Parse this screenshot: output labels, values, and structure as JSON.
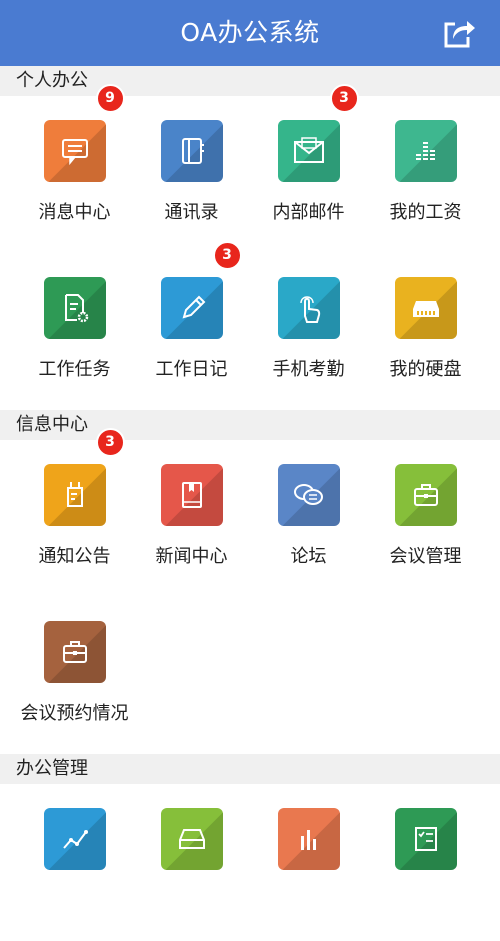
{
  "header": {
    "title": "OA办公系统"
  },
  "sections": [
    {
      "title": "个人办公",
      "items": [
        {
          "label": "消息中心",
          "icon": "message-icon",
          "color": "#ef7d3b",
          "badge": "9"
        },
        {
          "label": "通讯录",
          "icon": "address-book-icon",
          "color": "#4a84c9",
          "badge": ""
        },
        {
          "label": "内部邮件",
          "icon": "mail-icon",
          "color": "#35b58b",
          "badge": "3"
        },
        {
          "label": "我的工资",
          "icon": "salary-icon",
          "color": "#3eb78f",
          "badge": ""
        },
        {
          "label": "工作任务",
          "icon": "task-icon",
          "color": "#2e9a55",
          "badge": ""
        },
        {
          "label": "工作日记",
          "icon": "pencil-icon",
          "color": "#2d9ad6",
          "badge": "3"
        },
        {
          "label": "手机考勤",
          "icon": "touch-icon",
          "color": "#2aa8c8",
          "badge": ""
        },
        {
          "label": "我的硬盘",
          "icon": "hard-disk-icon",
          "color": "#e9b21f",
          "badge": ""
        }
      ]
    },
    {
      "title": "信息中心",
      "items": [
        {
          "label": "通知公告",
          "icon": "notice-icon",
          "color": "#efa41a",
          "badge": "3"
        },
        {
          "label": "新闻中心",
          "icon": "news-book-icon",
          "color": "#e5574a",
          "badge": ""
        },
        {
          "label": "论坛",
          "icon": "forum-icon",
          "color": "#5a86c7",
          "badge": ""
        },
        {
          "label": "会议管理",
          "icon": "briefcase-icon",
          "color": "#86bf3a",
          "badge": ""
        },
        {
          "label": "会议预约情况",
          "icon": "briefcase-icon",
          "color": "#a5623e",
          "badge": ""
        }
      ]
    },
    {
      "title": "办公管理",
      "items": [
        {
          "label": "",
          "icon": "chart-line-icon",
          "color": "#2d9ad6",
          "badge": ""
        },
        {
          "label": "",
          "icon": "tray-icon",
          "color": "#86bf3a",
          "badge": ""
        },
        {
          "label": "",
          "icon": "bar-chart-icon",
          "color": "#e9784f",
          "badge": ""
        },
        {
          "label": "",
          "icon": "checklist-icon",
          "color": "#2e9a55",
          "badge": ""
        }
      ]
    }
  ]
}
